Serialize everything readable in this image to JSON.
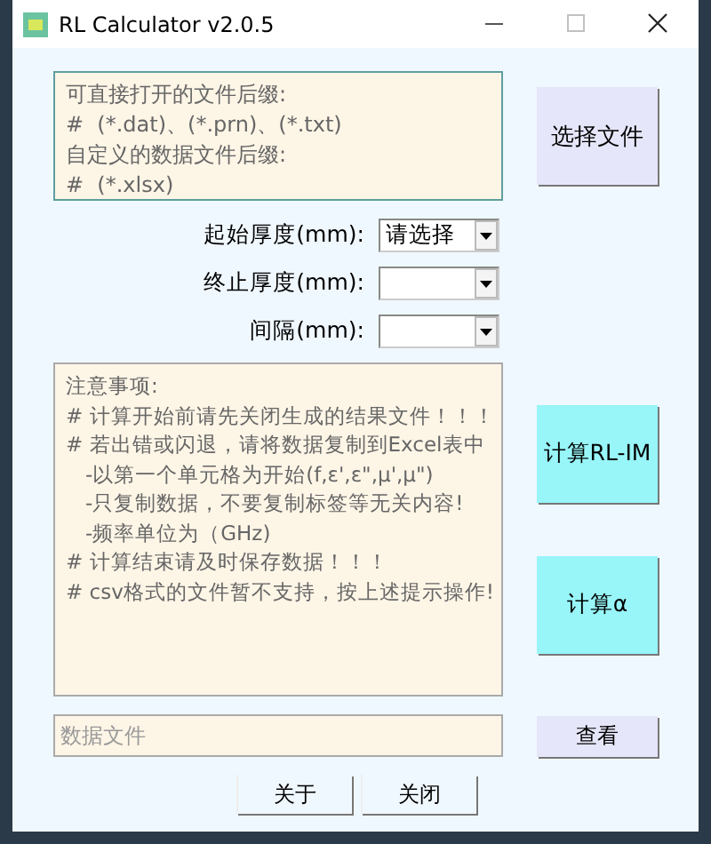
{
  "window": {
    "title": "RL Calculator v2.0.5"
  },
  "info_box": {
    "lines": [
      "可直接打开的文件后缀:",
      "#  (*.dat)、(*.prn)、(*.txt)",
      "自定义的数据文件后缀:",
      "#  (*.xlsx)"
    ]
  },
  "select_file_button": "选择文件",
  "fields": [
    {
      "label": "起始厚度(mm):",
      "value": "请选择"
    },
    {
      "label": "终止厚度(mm):"
    },
    {
      "label": "间隔(mm):"
    }
  ],
  "notes_box": {
    "lines": [
      "注意事项:",
      "# 计算开始前请先关闭生成的结果文件！！！",
      "# 若出错或闪退，请将数据复制到Excel表中",
      "   -以第一个单元格为开始(f,ε',ε\",μ',μ\")",
      "   -只复制数据，不要复制标签等无关内容!",
      "   -频率单位为（GHz)",
      "# 计算结束请及时保存数据！！！",
      "# csv格式的文件暂不支持，按上述提示操作!"
    ]
  },
  "calc_buttons": [
    "计算RL-IM",
    "计算α"
  ],
  "data_file": {
    "placeholder": "数据文件"
  },
  "view_button": "查看",
  "bottom_buttons": [
    "关于",
    "关闭"
  ]
}
